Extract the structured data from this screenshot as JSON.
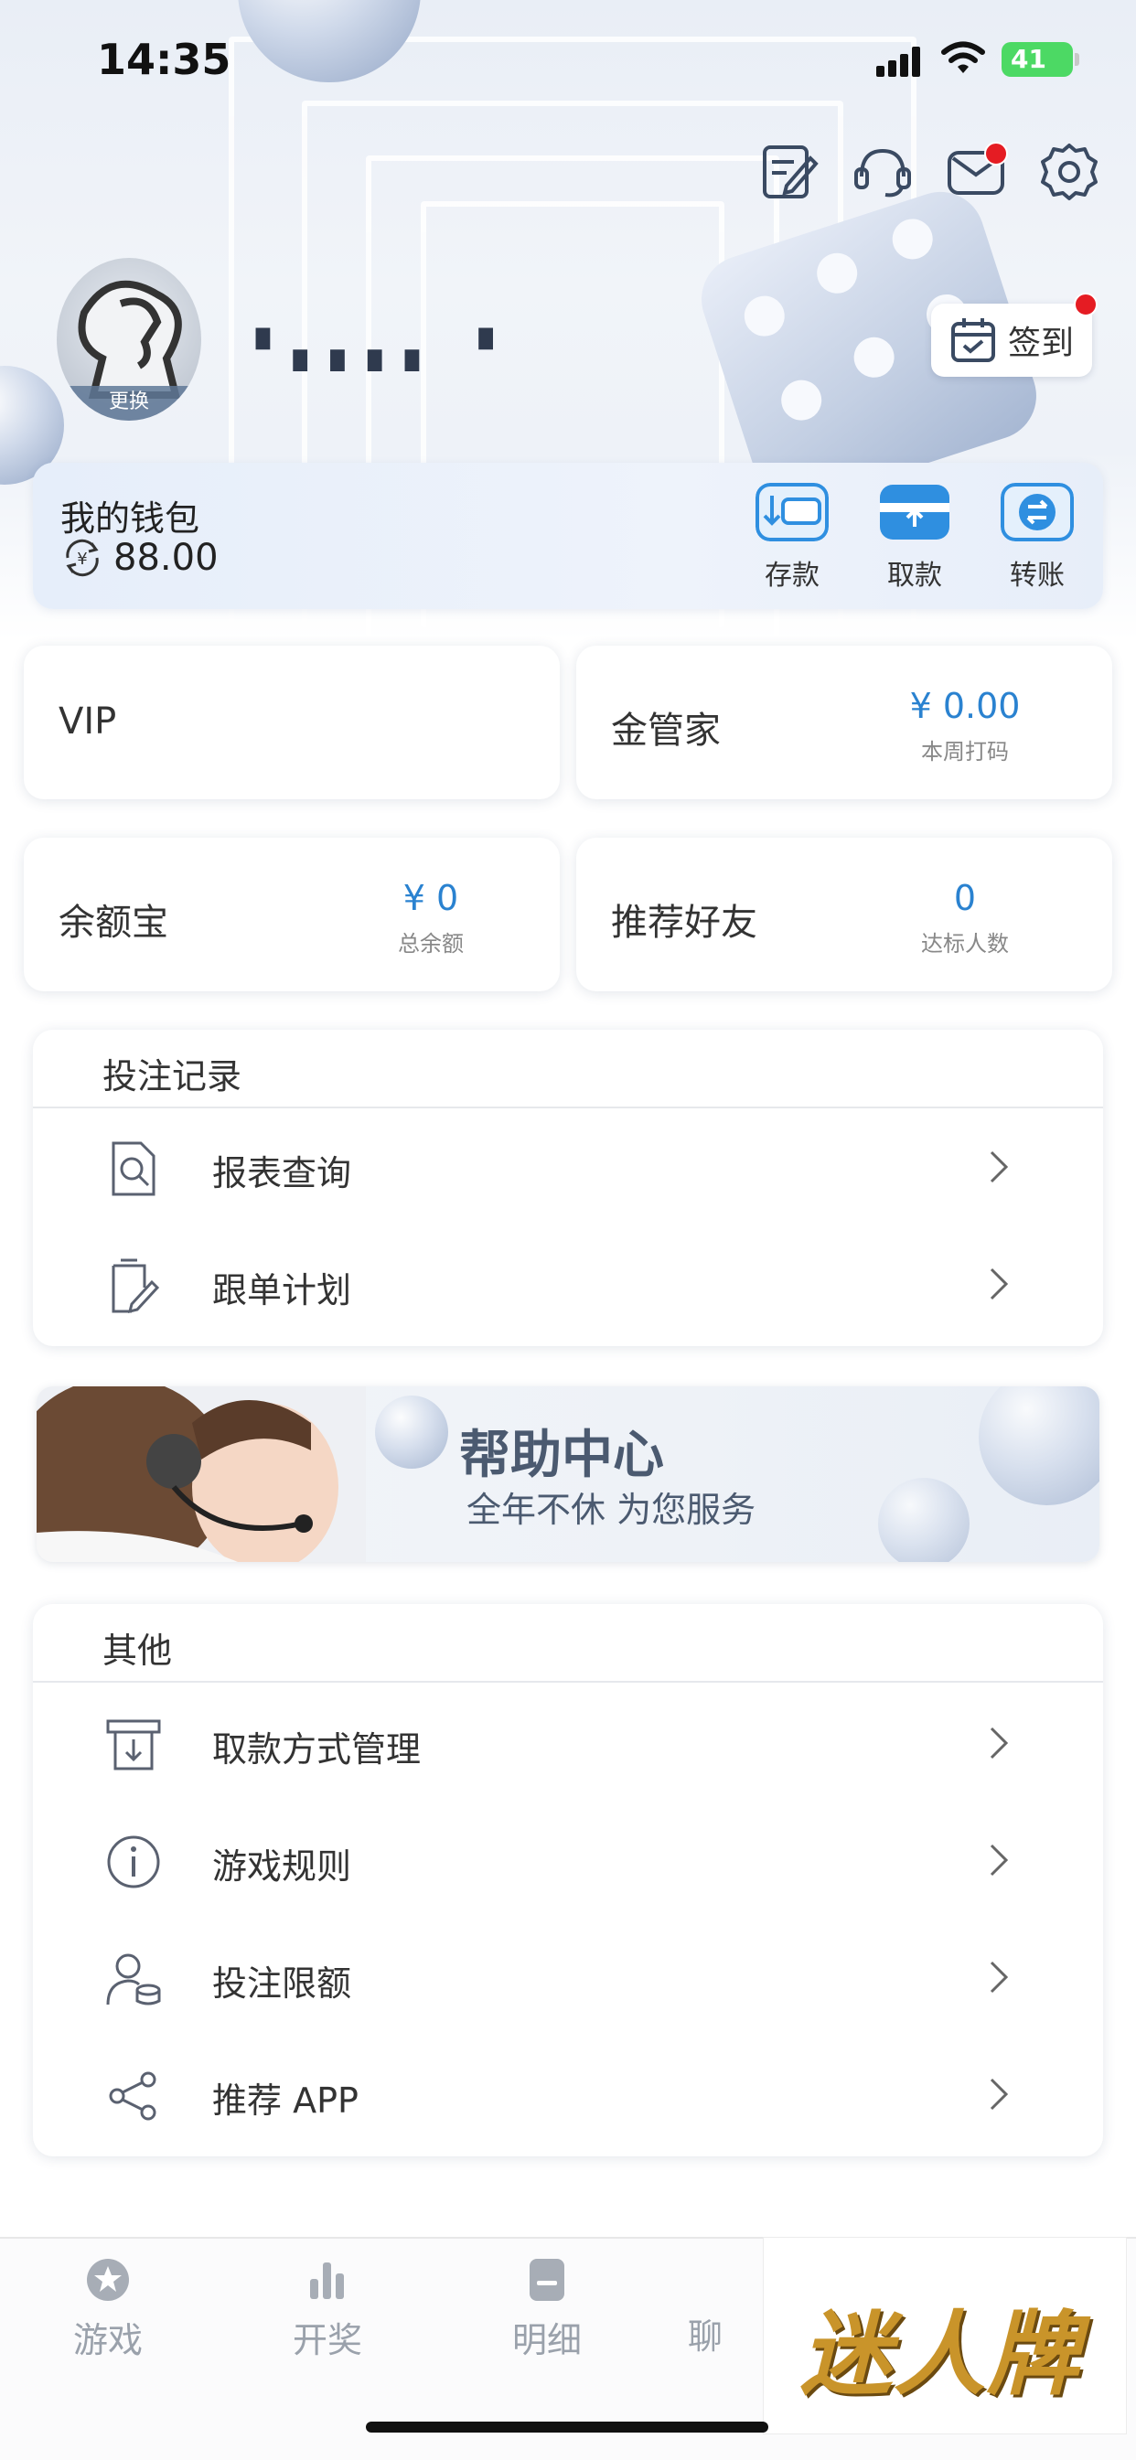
{
  "status_bar": {
    "time": "14:35",
    "battery": "41"
  },
  "profile": {
    "avatar_change_label": "更换",
    "username": "▘▖▖▖▖ ▝"
  },
  "checkin": {
    "label": "签到"
  },
  "wallet": {
    "title": "我的钱包",
    "amount": "88.00",
    "actions": [
      {
        "label": "存款",
        "icon": "deposit-icon"
      },
      {
        "label": "取款",
        "icon": "withdraw-icon"
      },
      {
        "label": "转账",
        "icon": "transfer-icon"
      }
    ]
  },
  "cards": {
    "vip": {
      "title": "VIP"
    },
    "butler": {
      "title": "金管家",
      "value": "¥ 0.00",
      "sub": "本周打码"
    },
    "balance_bao": {
      "title": "余额宝",
      "value": "¥ 0",
      "sub": "总余额"
    },
    "referral": {
      "title": "推荐好友",
      "value": "0",
      "sub": "达标人数"
    }
  },
  "bets_section": {
    "title": "投注记录",
    "items": [
      {
        "label": "报表查询",
        "icon": "report-search-icon"
      },
      {
        "label": "跟单计划",
        "icon": "follow-plan-icon"
      }
    ]
  },
  "help_banner": {
    "title": "帮助中心",
    "subtitle": "全年不休 为您服务"
  },
  "other_section": {
    "title": "其他",
    "items": [
      {
        "label": "取款方式管理",
        "icon": "withdraw-method-icon"
      },
      {
        "label": "游戏规则",
        "icon": "info-icon"
      },
      {
        "label": "投注限额",
        "icon": "bet-limit-icon"
      },
      {
        "label": "推荐 APP",
        "icon": "share-icon"
      }
    ]
  },
  "tabbar": {
    "items": [
      {
        "label": "游戏",
        "icon": "games-icon"
      },
      {
        "label": "开奖",
        "icon": "draw-chart-icon"
      },
      {
        "label": "明细",
        "icon": "details-icon"
      },
      {
        "label": "聊",
        "icon": "chat-icon"
      }
    ]
  },
  "overlay_logo": {
    "text": "迷人牌"
  },
  "colors": {
    "accent": "#2a82d0",
    "badge": "#e51c23",
    "wallet_icon": "#2f8fe0"
  }
}
